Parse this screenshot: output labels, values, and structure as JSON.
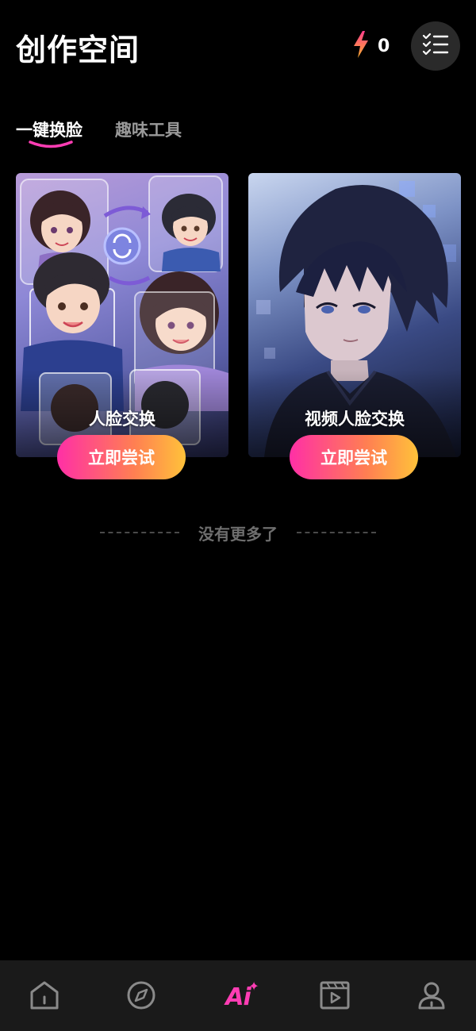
{
  "header": {
    "title": "创作空间",
    "energy_count": "0",
    "energy_icon": "lightning-icon",
    "menu_icon": "checklist-icon"
  },
  "tabs": [
    {
      "label": "一键换脸",
      "active": true
    },
    {
      "label": "趣味工具",
      "active": false
    }
  ],
  "cards": [
    {
      "title": "人脸交换",
      "button": "立即尝试"
    },
    {
      "title": "视频人脸交换",
      "button": "立即尝试"
    }
  ],
  "end_note": "没有更多了",
  "bottom_nav": {
    "items": [
      {
        "icon": "home-icon"
      },
      {
        "icon": "compass-icon"
      },
      {
        "label": "Ai",
        "icon": "ai-icon",
        "active": true
      },
      {
        "icon": "video-icon"
      },
      {
        "icon": "profile-icon"
      }
    ]
  },
  "colors": {
    "accent_pink": "#ff3db4",
    "button_gradient_start": "#ff2fa6",
    "button_gradient_end": "#ffc23a",
    "background": "#000000",
    "nav_background": "#1a1a1a"
  }
}
